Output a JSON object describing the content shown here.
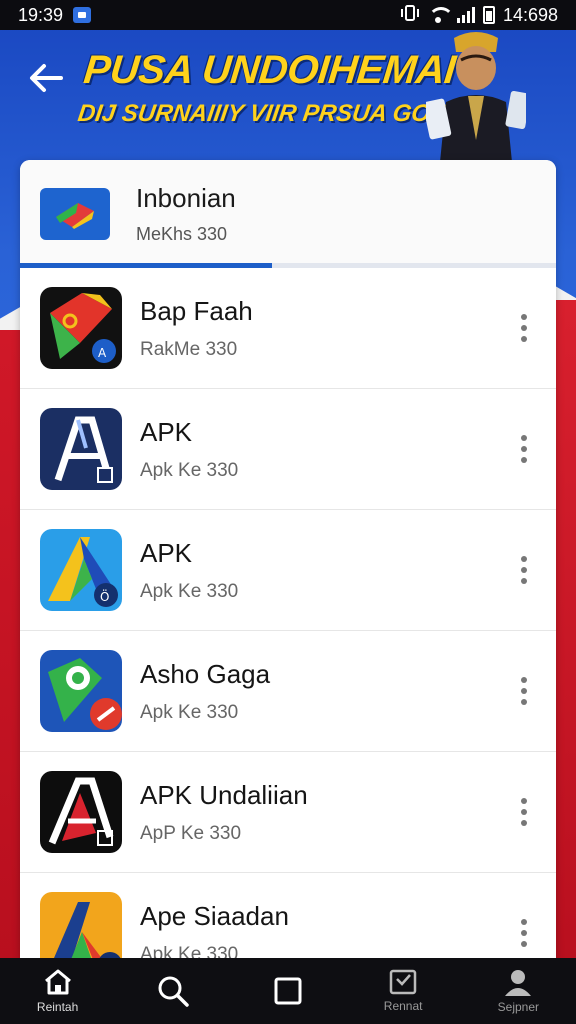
{
  "status_bar": {
    "time": "19:39",
    "right_text": "14:698"
  },
  "banner": {
    "title": "PUSA UNDOIHEMAI",
    "subtitle": "DIJ SURNAIIIY VIIR PRSUA GOYANI"
  },
  "header": {
    "title": "Inbonian",
    "subtitle": "MeKhs 330",
    "progress_fraction": 0.47
  },
  "apps": [
    {
      "name": "Bap Faah",
      "subtitle": "RakMe 330"
    },
    {
      "name": "APK",
      "subtitle": "Apk Ke 330"
    },
    {
      "name": "APK",
      "subtitle": "Apk Ke 330"
    },
    {
      "name": "Asho Gaga",
      "subtitle": "Apk Ke 330"
    },
    {
      "name": "APK Undaliian",
      "subtitle": "ApP Ke 330"
    },
    {
      "name": "Ape Siaadan",
      "subtitle": "Apk Ke 330"
    }
  ],
  "nav": [
    {
      "label": "Reintah",
      "icon": "home-icon"
    },
    {
      "label": "",
      "icon": "search-icon"
    },
    {
      "label": "",
      "icon": "square-icon"
    },
    {
      "label": "Rennat",
      "icon": "inbox-icon"
    },
    {
      "label": "Sejpner",
      "icon": "profile-icon"
    }
  ],
  "colors": {
    "accent": "#1d5ec8",
    "banner_text": "#ffd21c"
  }
}
